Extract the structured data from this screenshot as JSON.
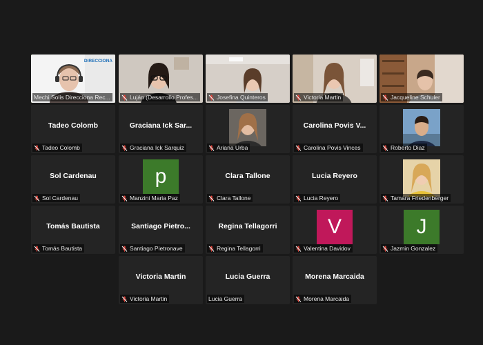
{
  "colors": {
    "background": "#1a1a1a",
    "tile": "#242424",
    "active_border": "#b9d637",
    "mic_muted": "#e0443a",
    "avatar_green": "#3c7a2a",
    "avatar_magenta": "#c0185a"
  },
  "speaker": {
    "name": "Mechi Solis Direcciona Rec...",
    "logo_text": "DIRECCIONA"
  },
  "row1": [
    {
      "name": "Luján (Desarrollo Profes..."
    },
    {
      "name": "Josefina Quinteros"
    },
    {
      "name": "Victoria Martin"
    },
    {
      "name": "Jacqueline Schuler"
    }
  ],
  "row2": [
    {
      "big": "Tadeo Colomb",
      "name": "Tadeo Colomb"
    },
    {
      "big": "Graciana  Ick  Sar...",
      "name": "Graciana Ick Sarquiz"
    },
    {
      "name": "Ariana Urba"
    },
    {
      "big": "Carolina  Povis  V...",
      "name": "Carolina Povis Vinces"
    },
    {
      "name": "Roberto Diaz"
    }
  ],
  "row3": [
    {
      "big": "Sol Cardenau",
      "name": "Sol Cardenau"
    },
    {
      "avatar": "p",
      "name": "Manzini Maria Paz"
    },
    {
      "big": "Clara Tallone",
      "name": "Clara Tallone"
    },
    {
      "big": "Lucia Reyero",
      "name": "Lucia Reyero"
    },
    {
      "name": "Tamara Friedenberger"
    }
  ],
  "row4": [
    {
      "big": "Tomás Bautista",
      "name": "Tomás Bautista"
    },
    {
      "big": "Santiago  Pietro...",
      "name": "Santiago Pietronave"
    },
    {
      "big": "Regina Tellagorri",
      "name": "Regina Tellagorri"
    },
    {
      "avatar": "V",
      "name": "Valentina Davidov"
    },
    {
      "avatar": "J",
      "name": "Jazmin Gonzalez"
    }
  ],
  "row5": [
    {
      "big": "Victoria Martin",
      "name": "Victoria Martin"
    },
    {
      "big": "Lucia Guerra",
      "name": "Lucia Guerra"
    },
    {
      "big": "Morena Marcaida",
      "name": "Morena Marcaida"
    }
  ]
}
